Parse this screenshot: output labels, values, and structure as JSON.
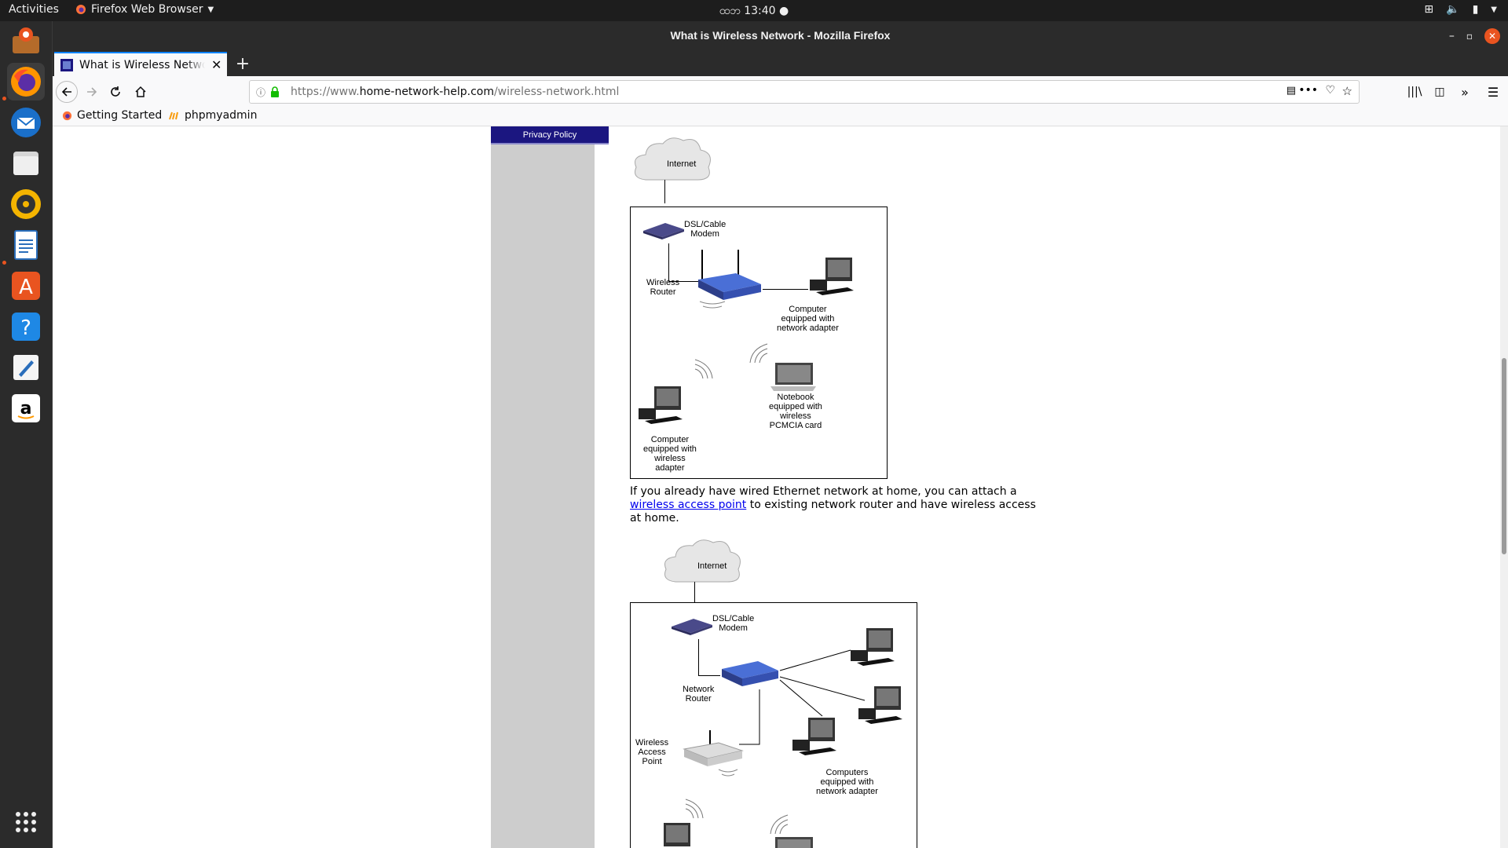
{
  "topbar": {
    "activities": "Activities",
    "app_menu": "Firefox Web Browser",
    "clock_prefix": "ထဘ",
    "clock": "13:40"
  },
  "window": {
    "title": "What is Wireless Network - Mozilla Firefox"
  },
  "tab": {
    "title": "What is Wireless Network"
  },
  "url": {
    "prefix": "https://www.",
    "host": "home-network-help.com",
    "path": "/wireless-network.html"
  },
  "bookmarks": [
    {
      "label": "Getting Started"
    },
    {
      "label": "phpmyadmin"
    }
  ],
  "page": {
    "privacy": "Privacy Policy",
    "paragraph_before": "If you already have wired Ethernet network at home, you can attach a ",
    "link": "wireless access point",
    "paragraph_after": " to existing network router and have wireless access at home."
  },
  "diagram1": {
    "internet": "Internet",
    "modem": "DSL/Cable\nModem",
    "router": "Wireless\nRouter",
    "computer_wired": "Computer\nequipped with\nnetwork adapter",
    "notebook": "Notebook\nequipped with\nwireless\nPCMCIA card",
    "computer_wireless": "Computer\nequipped with\nwireless\nadapter"
  },
  "diagram2": {
    "internet": "Internet",
    "modem": "DSL/Cable\nModem",
    "router": "Network\nRouter",
    "ap": "Wireless\nAccess\nPoint",
    "computers": "Computers\nequipped with\nnetwork adapter"
  },
  "colors": {
    "accent": "#0a84ff",
    "privacy_bg": "#1b1680",
    "dock_bg": "#2b2b2b"
  }
}
